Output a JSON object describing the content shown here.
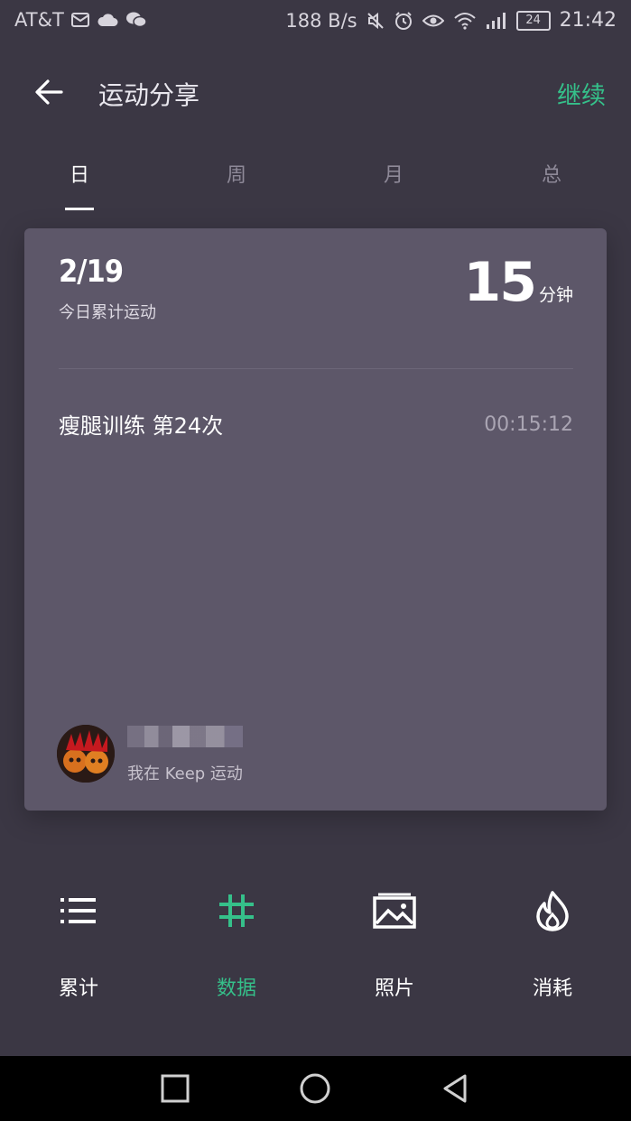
{
  "status_bar": {
    "carrier": "AT&T",
    "net_speed": "188 B/s",
    "battery": "24",
    "time": "21:42"
  },
  "header": {
    "title": "运动分享",
    "continue_label": "继续"
  },
  "tabs": [
    {
      "label": "日",
      "active": true
    },
    {
      "label": "周",
      "active": false
    },
    {
      "label": "月",
      "active": false
    },
    {
      "label": "总",
      "active": false
    }
  ],
  "card": {
    "date": "2/19",
    "subtitle": "今日累计运动",
    "duration_value": "15",
    "duration_unit": "分钟",
    "workout": {
      "name": "瘦腿训练 第24次",
      "time": "00:15:12"
    },
    "user_caption": "我在 Keep 运动"
  },
  "options": [
    {
      "label": "累计",
      "icon": "list-icon",
      "active": false
    },
    {
      "label": "数据",
      "icon": "hash-icon",
      "active": true
    },
    {
      "label": "照片",
      "icon": "image-icon",
      "active": false
    },
    {
      "label": "消耗",
      "icon": "flame-icon",
      "active": false
    }
  ],
  "colors": {
    "background": "#3b3744",
    "card": "#5d5769",
    "accent": "#35c08a"
  }
}
